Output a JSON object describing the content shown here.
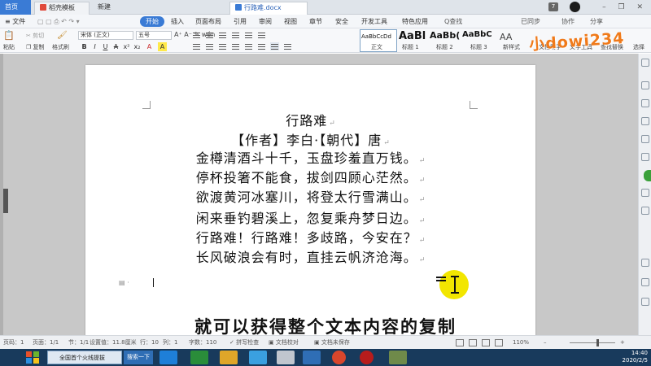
{
  "tabbar": {
    "home": "首页",
    "template_tab": "稻壳模板",
    "new_tab": "新建",
    "doc_tab": "行路难.docx",
    "badge": "7"
  },
  "menubar": {
    "file": "≡ 文件",
    "items": [
      "开始",
      "插入",
      "页面布局",
      "引用",
      "审阅",
      "视图",
      "章节",
      "安全",
      "开发工具",
      "特色应用"
    ],
    "active_index": 0,
    "search": "Q查找",
    "sync": "已同步",
    "collab": "协作",
    "share": "分享"
  },
  "ribbon": {
    "paste": "粘贴",
    "cut": "剪切",
    "copy": "复制",
    "format_painter": "格式刷",
    "font_name": "宋体 (正文)",
    "font_size": "五号",
    "styles": [
      {
        "sample": "AaBbCcDd",
        "label": "正文"
      },
      {
        "sample": "AaBl",
        "label": "标题 1"
      },
      {
        "sample": "AaBb(",
        "label": "标题 2"
      },
      {
        "sample": "AaBbC",
        "label": "标题 3"
      }
    ],
    "new_style": "新样式",
    "writer": "文档助手",
    "text_tools": "文字工具",
    "find_replace": "查找替换",
    "select": "选择",
    "logo": "小dowi234",
    "format_buttons": [
      "B",
      "I",
      "U",
      "A",
      "x²",
      "x₂",
      "A",
      "A"
    ]
  },
  "document": {
    "lines": [
      "行路难",
      "【作者】李白·【朝代】唐",
      "金樽清酒斗十千，玉盘珍羞直万钱。",
      "停杯投箸不能食，拔剑四顾心茫然。",
      "欲渡黄河冰塞川，将登太行雪满山。",
      "闲来垂钓碧溪上，忽复乘舟梦日边。",
      "行路难！行路难！多歧路，今安在？",
      "长风破浪会有时，直挂云帆济沧海。"
    ],
    "para_mark": "↵",
    "caption": "就可以获得整个文本内容的复制"
  },
  "statusbar": {
    "page": "页码：1",
    "pages": "页面：1/1",
    "section": "节：1/1",
    "setting": "设置值：11.8厘米",
    "row": "行：10",
    "col": "列：1",
    "words": "字数：110",
    "spellcheck": "拼写检查",
    "proofread": "文档校对",
    "unsaved": "文档未保存",
    "zoom": "110%"
  },
  "taskbar": {
    "input": "全国首个火线提拔",
    "search": "搜索一下",
    "time": "14:40",
    "date": "2020/2/5"
  },
  "colors": {
    "accent": "#3a7bd5",
    "logo": "#f07a1a",
    "highlight": "#f2e600",
    "taskbar": "#183a5c"
  }
}
